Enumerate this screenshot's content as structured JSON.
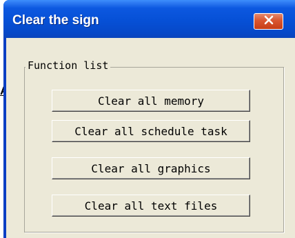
{
  "background": {
    "fragment_text": "A"
  },
  "window": {
    "title": "Clear the sign",
    "close_icon": "close-icon",
    "titlebar_color": "#0650d6",
    "close_button_color": "#d9552f",
    "client_color": "#ece9d8"
  },
  "function_list": {
    "legend": "Function list",
    "buttons": [
      {
        "label": "Clear all memory"
      },
      {
        "label": "Clear all schedule task"
      },
      {
        "label": "Clear all graphics"
      },
      {
        "label": "Clear all text files"
      }
    ]
  }
}
